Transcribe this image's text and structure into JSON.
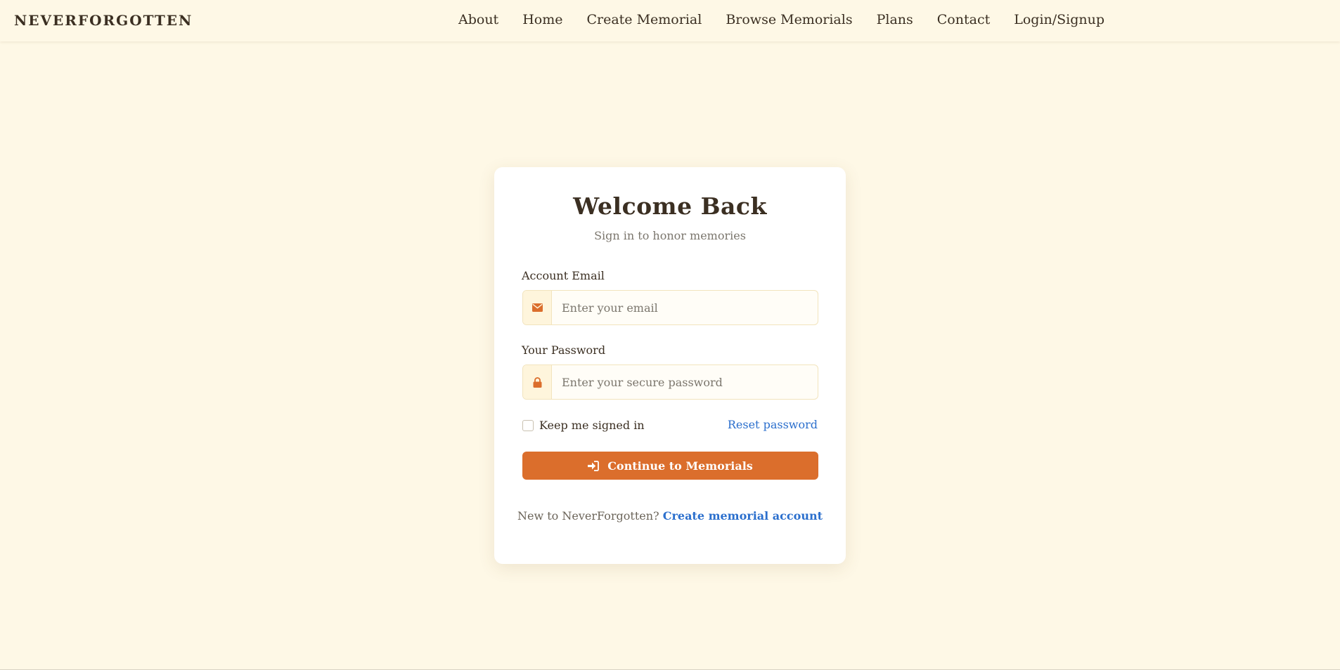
{
  "nav": {
    "brand": "NEVERFORGOTTEN",
    "links": [
      {
        "label": "About"
      },
      {
        "label": "Home"
      },
      {
        "label": "Create Memorial"
      },
      {
        "label": "Browse Memorials"
      },
      {
        "label": "Plans"
      },
      {
        "label": "Contact"
      },
      {
        "label": "Login/Signup"
      }
    ]
  },
  "login": {
    "title": "Welcome Back",
    "subtitle": "Sign in to honor memories",
    "email": {
      "label": "Account Email",
      "placeholder": "Enter your email",
      "value": "",
      "icon": "envelope-icon"
    },
    "password": {
      "label": "Your Password",
      "placeholder": "Enter your secure password",
      "value": "",
      "icon": "lock-icon"
    },
    "remember_label": "Keep me signed in",
    "remember_checked": false,
    "reset_label": "Reset password",
    "submit_label": "Continue to Memorials",
    "submit_icon": "sign-in-icon",
    "signup_prompt": "New to NeverForgotten?",
    "signup_link": "Create memorial account"
  },
  "colors": {
    "background": "#fef8e6",
    "accent": "#db6e2c",
    "link": "#2b6fcd",
    "text": "#3b2f22"
  }
}
